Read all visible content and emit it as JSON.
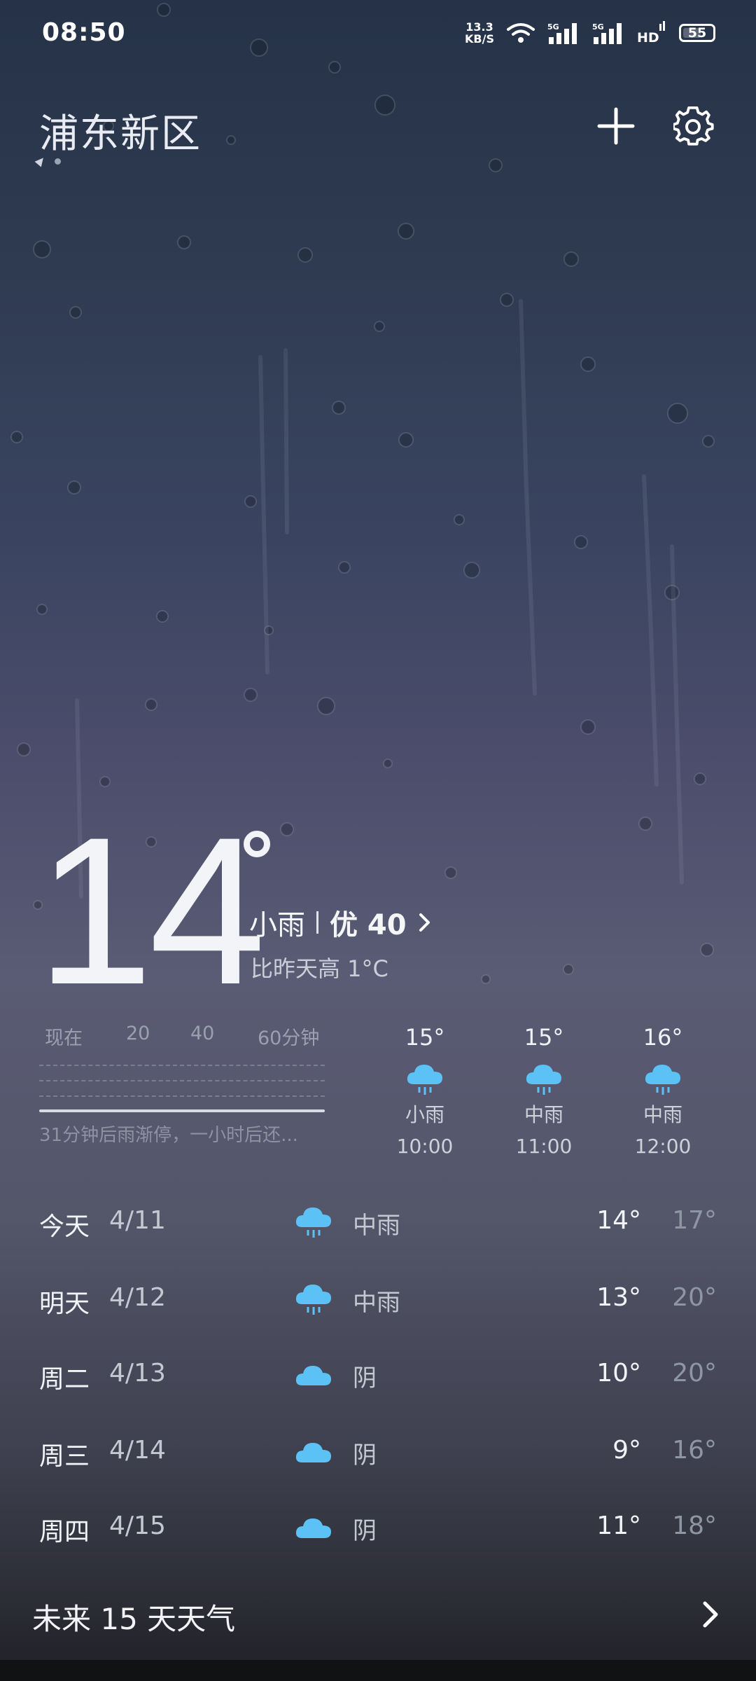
{
  "status_bar": {
    "time": "08:50",
    "net_speed_value": "13.3",
    "net_speed_unit": "KB/S",
    "battery": "55",
    "signal_label_1": "5G",
    "signal_label_2": "5G",
    "hd_label": "HD"
  },
  "header": {
    "city": "浦东新区"
  },
  "current": {
    "temperature": "14",
    "condition": "小雨",
    "aqi": "优 40",
    "compare": "比昨天高 1°C"
  },
  "minute_forecast": {
    "labels": [
      "现在",
      "20",
      "40",
      "60分钟"
    ],
    "summary": "31分钟后雨渐停，一小时后还..."
  },
  "hourly": [
    {
      "temp": "15°",
      "condition": "小雨",
      "time": "10:00",
      "icon": "rain-cloud-icon"
    },
    {
      "temp": "15°",
      "condition": "中雨",
      "time": "11:00",
      "icon": "rain-cloud-icon"
    },
    {
      "temp": "16°",
      "condition": "中雨",
      "time": "12:00",
      "icon": "rain-cloud-icon"
    }
  ],
  "daily": [
    {
      "day": "今天",
      "date": "4/11",
      "condition": "中雨",
      "low": "14°",
      "high": "17°",
      "icon": "rain-cloud-icon"
    },
    {
      "day": "明天",
      "date": "4/12",
      "condition": "中雨",
      "low": "13°",
      "high": "20°",
      "icon": "rain-cloud-icon"
    },
    {
      "day": "周二",
      "date": "4/13",
      "condition": "阴",
      "low": "10°",
      "high": "20°",
      "icon": "cloud-icon"
    },
    {
      "day": "周三",
      "date": "4/14",
      "condition": "阴",
      "low": "9°",
      "high": "16°",
      "icon": "cloud-icon"
    },
    {
      "day": "周四",
      "date": "4/15",
      "condition": "阴",
      "low": "11°",
      "high": "18°",
      "icon": "cloud-icon"
    }
  ],
  "footer": {
    "forecast_link": "未来 15 天天气"
  },
  "colors": {
    "icon_blue": "#5cc2f5",
    "bg_top": "#253247",
    "bg_mid": "#5a5b74"
  }
}
